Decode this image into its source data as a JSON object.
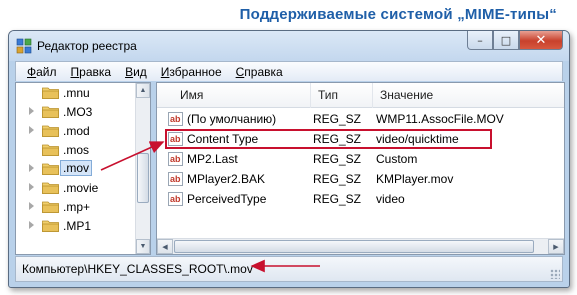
{
  "caption": "Поддерживаемые системой „MIME-типы“",
  "window": {
    "title": "Редактор реестра",
    "buttons": {
      "minimize": "–",
      "maximize": "□",
      "close": "✕"
    }
  },
  "menu": [
    {
      "underline": "Ф",
      "rest": "айл"
    },
    {
      "underline": "П",
      "rest": "равка"
    },
    {
      "underline": "В",
      "rest": "ид"
    },
    {
      "underline": "И",
      "rest": "збранное"
    },
    {
      "underline": "С",
      "rest": "правка"
    }
  ],
  "tree": {
    "items": [
      {
        "label": ".mnu",
        "expandable": false
      },
      {
        "label": ".MO3",
        "expandable": true
      },
      {
        "label": ".mod",
        "expandable": true
      },
      {
        "label": ".mos",
        "expandable": false
      },
      {
        "label": ".mov",
        "expandable": true,
        "selected": true
      },
      {
        "label": ".movie",
        "expandable": true
      },
      {
        "label": ".mp+",
        "expandable": true
      },
      {
        "label": ".MP1",
        "expandable": true
      }
    ]
  },
  "list": {
    "columns": [
      "Имя",
      "Тип",
      "Значение"
    ],
    "rows": [
      {
        "name": "(По умолчанию)",
        "type": "REG_SZ",
        "value": "WMP11.AssocFile.MOV"
      },
      {
        "name": "Content Type",
        "type": "REG_SZ",
        "value": "video/quicktime",
        "highlighted": true
      },
      {
        "name": "MP2.Last",
        "type": "REG_SZ",
        "value": "Custom"
      },
      {
        "name": "MPlayer2.BAK",
        "type": "REG_SZ",
        "value": "KMPlayer.mov"
      },
      {
        "name": "PerceivedType",
        "type": "REG_SZ",
        "value": "video"
      }
    ]
  },
  "statusbar": {
    "path": "Компьютер\\HKEY_CLASSES_ROOT\\.mov"
  },
  "colors": {
    "caption": "#1f5fa8",
    "annotation": "#c8102e",
    "folder": "#e8c15a",
    "reg_icon_text": "#c0392b"
  },
  "icons": {
    "app": "registry-editor-icon",
    "folder": "folder-icon",
    "value": "string-value-ab-icon"
  }
}
